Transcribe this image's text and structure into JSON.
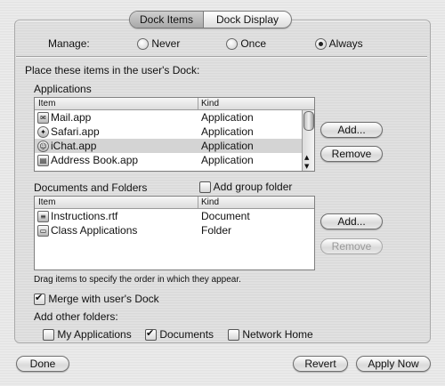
{
  "tabs": {
    "dock_items": "Dock Items",
    "dock_display": "Dock Display"
  },
  "manage": {
    "label": "Manage:",
    "never": "Never",
    "once": "Once",
    "always": "Always",
    "selected": "Always"
  },
  "place_label": "Place these items in the user's Dock:",
  "applications": {
    "heading": "Applications",
    "col_item": "Item",
    "col_kind": "Kind",
    "rows": [
      {
        "name": "Mail.app",
        "kind": "Application",
        "icon": "mail-stamp-icon"
      },
      {
        "name": "Safari.app",
        "kind": "Application",
        "icon": "compass-icon"
      },
      {
        "name": "iChat.app",
        "kind": "Application",
        "icon": "chat-bubble-icon",
        "selected": true
      },
      {
        "name": "Address Book.app",
        "kind": "Application",
        "icon": "address-book-icon"
      }
    ],
    "add_label": "Add...",
    "remove_label": "Remove"
  },
  "documents": {
    "heading": "Documents and Folders",
    "add_group_label": "Add group folder",
    "col_item": "Item",
    "col_kind": "Kind",
    "rows": [
      {
        "name": "Instructions.rtf",
        "kind": "Document",
        "icon": "document-icon"
      },
      {
        "name": "Class Applications",
        "kind": "Folder",
        "icon": "folder-icon"
      }
    ],
    "add_label": "Add...",
    "remove_label": "Remove",
    "hint": "Drag items to specify the order in which they appear."
  },
  "merge_label": "Merge with user's Dock",
  "other_folders": {
    "label": "Add other folders:",
    "my_applications": "My Applications",
    "documents": "Documents",
    "network_home": "Network Home"
  },
  "footer": {
    "done": "Done",
    "revert": "Revert",
    "apply": "Apply Now"
  }
}
